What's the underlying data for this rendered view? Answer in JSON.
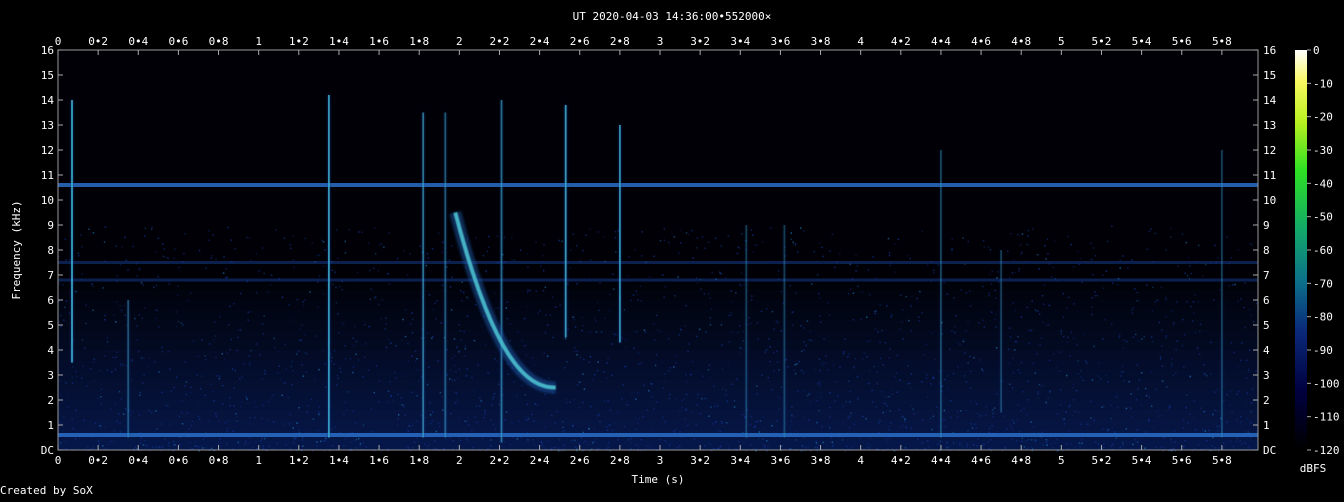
{
  "chart_data": {
    "type": "heatmap",
    "title": "UT 2020-04-03 14:36:00•552000×",
    "xlabel": "Time (s)",
    "ylabel": "Frequency (kHz)",
    "footer": "Created by SoX",
    "x_ticks": [
      "0",
      "0•2",
      "0•4",
      "0•6",
      "0•8",
      "1",
      "1•2",
      "1•4",
      "1•6",
      "1•8",
      "2",
      "2•2",
      "2•4",
      "2•6",
      "2•8",
      "3",
      "3•2",
      "3•4",
      "3•6",
      "3•8",
      "4",
      "4•2",
      "4•4",
      "4•6",
      "4•8",
      "5",
      "5•2",
      "5•4",
      "5•6",
      "5•8"
    ],
    "y_ticks": [
      "DC",
      "1",
      "2",
      "3",
      "4",
      "5",
      "6",
      "7",
      "8",
      "9",
      "10",
      "11",
      "12",
      "13",
      "14",
      "15",
      "16"
    ],
    "xlim": [
      0,
      5.98
    ],
    "ylim": [
      0,
      16
    ],
    "colorbar": {
      "label": "dBFS",
      "ticks": [
        "0",
        "-10",
        "-20",
        "-30",
        "-40",
        "-50",
        "-60",
        "-70",
        "-80",
        "-90",
        "-100",
        "-110",
        "-120"
      ],
      "range": [
        -120,
        0
      ]
    },
    "features": {
      "hum_lines_khz": [
        0.6,
        10.6,
        6.8,
        7.5
      ],
      "impulses": [
        {
          "t": 0.07,
          "f_min": 3.5,
          "f_max": 14.0,
          "strength": 0.85
        },
        {
          "t": 0.35,
          "f_min": 0.5,
          "f_max": 6.0,
          "strength": 0.4
        },
        {
          "t": 1.35,
          "f_min": 0.5,
          "f_max": 14.2,
          "strength": 0.8
        },
        {
          "t": 1.82,
          "f_min": 0.5,
          "f_max": 13.5,
          "strength": 0.6
        },
        {
          "t": 1.93,
          "f_min": 0.5,
          "f_max": 13.5,
          "strength": 0.45
        },
        {
          "t": 2.21,
          "f_min": 0.3,
          "f_max": 14.0,
          "strength": 0.55
        },
        {
          "t": 2.53,
          "f_min": 4.5,
          "f_max": 13.8,
          "strength": 0.8
        },
        {
          "t": 2.8,
          "f_min": 4.3,
          "f_max": 13.0,
          "strength": 0.75
        },
        {
          "t": 3.43,
          "f_min": 0.5,
          "f_max": 9.0,
          "strength": 0.3
        },
        {
          "t": 3.62,
          "f_min": 0.5,
          "f_max": 9.0,
          "strength": 0.3
        },
        {
          "t": 4.4,
          "f_min": 0.5,
          "f_max": 12.0,
          "strength": 0.35
        },
        {
          "t": 4.7,
          "f_min": 1.5,
          "f_max": 8.0,
          "strength": 0.3
        },
        {
          "t": 5.8,
          "f_min": 0.5,
          "f_max": 12.0,
          "strength": 0.3
        }
      ],
      "whistler": {
        "t0": 1.98,
        "f0": 9.5,
        "t1": 2.48,
        "f1": 2.5,
        "strength": 0.9
      }
    }
  }
}
